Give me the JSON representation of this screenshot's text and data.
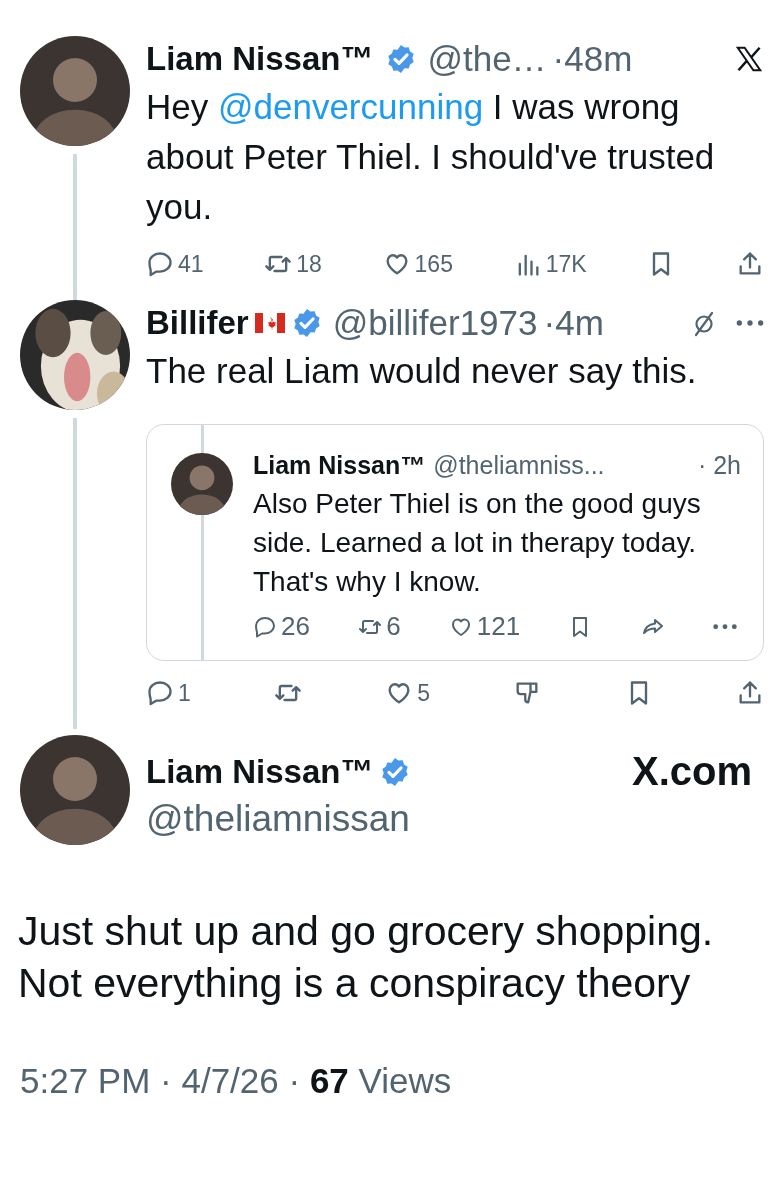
{
  "thread": [
    {
      "name": "Liam Nissan™",
      "flag": false,
      "verified": true,
      "handle": "@the…",
      "time": "·48m",
      "corner_icons": [
        {
          "kind": "x-logo"
        }
      ],
      "avatar": {
        "kind": "person"
      },
      "text": {
        "before": "Hey ",
        "mention": "@denvercunning",
        "after": " I was wrong about Peter Thiel. I should've trusted you."
      },
      "actions": [
        {
          "kind": "reply",
          "count": "41"
        },
        {
          "kind": "repost",
          "count": "18"
        },
        {
          "kind": "like",
          "count": "165"
        },
        {
          "kind": "views",
          "count": "17K"
        },
        {
          "kind": "bookmark"
        },
        {
          "kind": "share"
        }
      ]
    },
    {
      "name": "Billifer",
      "flag": true,
      "verified": true,
      "handle": "@billifer1973",
      "time": "·4m",
      "corner_icons": [
        {
          "kind": "slashed-circle"
        },
        {
          "kind": "more"
        }
      ],
      "text": {
        "before": "The real Liam would never say this."
      },
      "quote": {
        "name": "Liam Nissan™",
        "handle": "@theliamniss...",
        "time": "· 2h",
        "text": "Also Peter Thiel is on the good guys side. Learned a lot in therapy today. That's why I know.",
        "actions": [
          {
            "kind": "reply",
            "count": "26"
          },
          {
            "kind": "repost",
            "count": "6"
          },
          {
            "kind": "like",
            "count": "121"
          },
          {
            "kind": "bookmark"
          },
          {
            "kind": "forward"
          },
          {
            "kind": "more"
          }
        ]
      },
      "actions": [
        {
          "kind": "reply",
          "count": "1"
        },
        {
          "kind": "repost"
        },
        {
          "kind": "like",
          "count": "5"
        },
        {
          "kind": "dislike"
        },
        {
          "kind": "bookmark"
        },
        {
          "kind": "share"
        }
      ]
    }
  ],
  "main": {
    "name": "Liam Nissan™",
    "verified": true,
    "handle": "@theliamnissan",
    "brand": "X.com",
    "text": "Just shut up and go grocery shopping. Not everything is a conspiracy theory",
    "footer": "5:27 PM · 4/7/26 · **67** Views"
  }
}
